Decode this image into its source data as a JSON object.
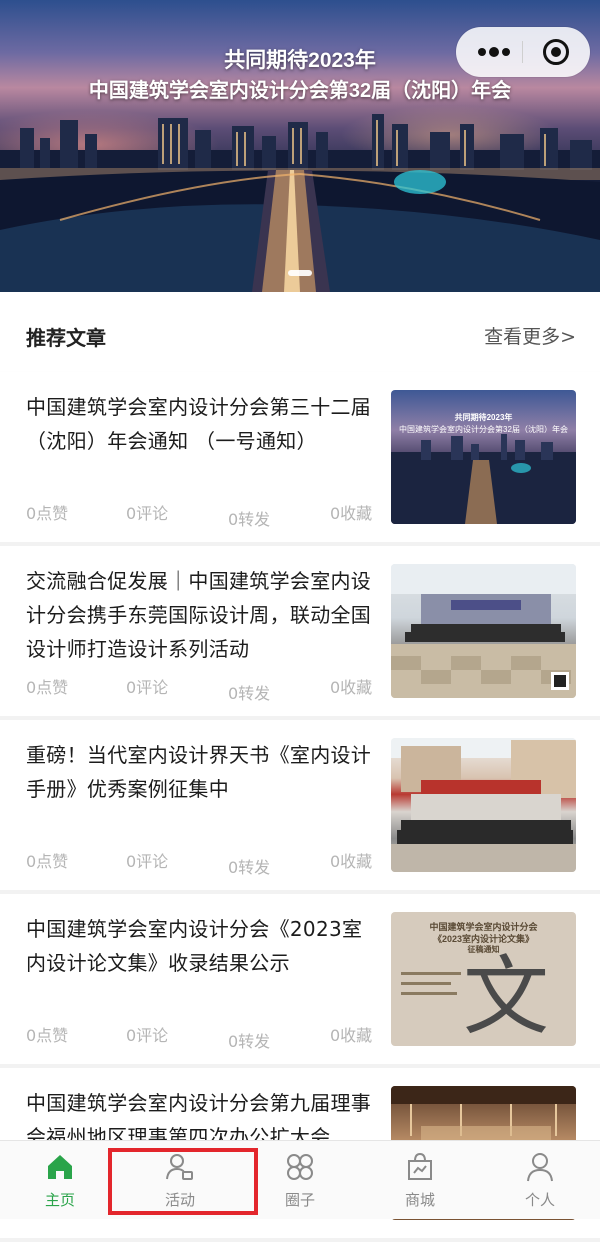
{
  "banner": {
    "line1": "共同期待2023年",
    "line2": "中国建筑学会室内设计分会第32届（沈阳）年会"
  },
  "capsule": {
    "more_icon": "more-dots-icon",
    "close_icon": "target-circle-icon"
  },
  "section": {
    "title": "推荐文章",
    "more": "查看更多>"
  },
  "articles": [
    {
      "title": "中国建筑学会室内设计分会第三十二届（沈阳）年会通知 （一号通知）",
      "likes": "0点赞",
      "comments": "0评论",
      "shares": "0转发",
      "favorites": "0收藏",
      "thumb_caption1": "共同期待2023年",
      "thumb_caption2": "中国建筑学会室内设计分会第32届（沈阳）年会"
    },
    {
      "title": "交流融合促发展｜中国建筑学会室内设计分会携手东莞国际设计周，联动全国设计师打造设计系列活动",
      "likes": "0点赞",
      "comments": "0评论",
      "shares": "0转发",
      "favorites": "0收藏"
    },
    {
      "title": "重磅！当代室内设计界天书《室内设计手册》优秀案例征集中",
      "likes": "0点赞",
      "comments": "0评论",
      "shares": "0转发",
      "favorites": "0收藏"
    },
    {
      "title": "中国建筑学会室内设计分会《2023室内设计论文集》收录结果公示",
      "likes": "0点赞",
      "comments": "0评论",
      "shares": "0转发",
      "favorites": "0收藏",
      "thumb_caption1": "中国建筑学会室内设计分会",
      "thumb_caption2": "《2023室内设计论文集》",
      "thumb_caption3": "征稿通知",
      "thumb_glyph": "文"
    },
    {
      "title": "中国建筑学会室内设计分会第九届理事会福州地区理事第四次办公扩大会"
    }
  ],
  "tabs": [
    {
      "label": "主页",
      "icon": "home-icon",
      "active": true
    },
    {
      "label": "活动",
      "icon": "activity-user-icon",
      "active": false
    },
    {
      "label": "圈子",
      "icon": "circles-icon",
      "active": false
    },
    {
      "label": "商城",
      "icon": "shop-bag-icon",
      "active": false
    },
    {
      "label": "个人",
      "icon": "person-icon",
      "active": false
    }
  ],
  "colors": {
    "accent": "#2aa44a",
    "highlight": "#e3262c",
    "muted": "#b5b5b5"
  }
}
